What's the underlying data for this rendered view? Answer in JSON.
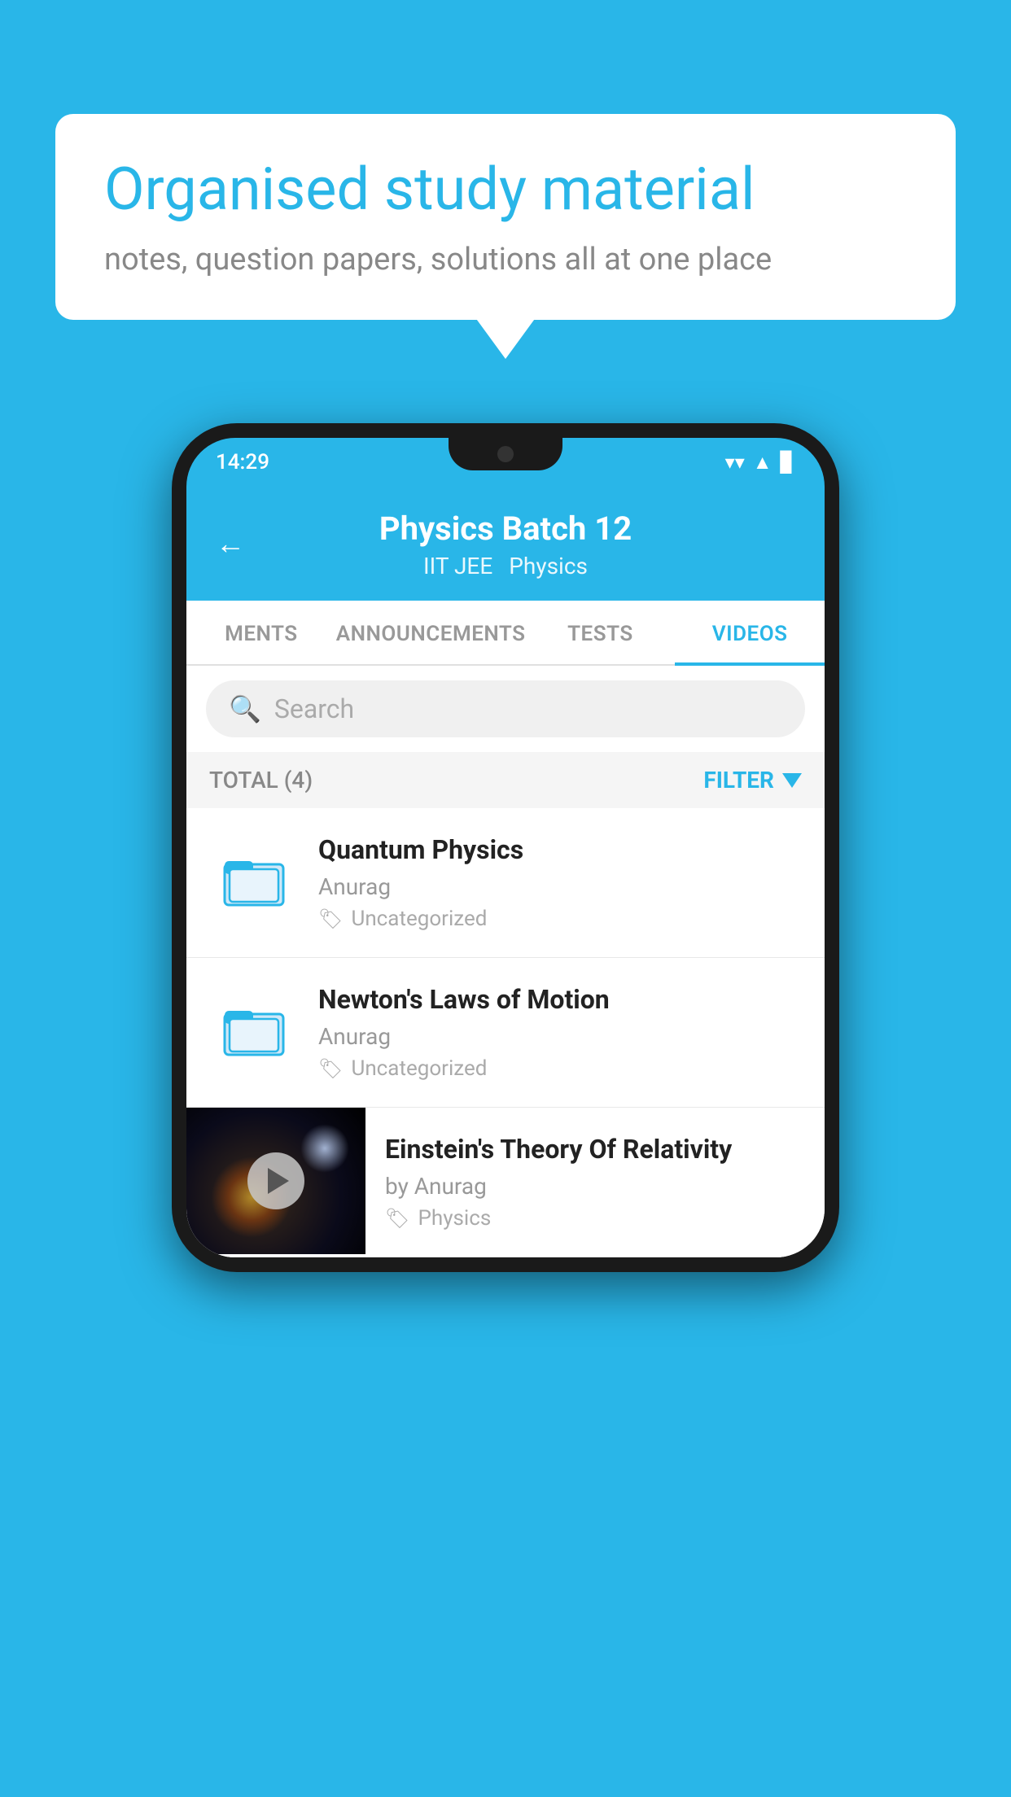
{
  "background_color": "#29b6e8",
  "speech_bubble": {
    "title": "Organised study material",
    "subtitle": "notes, question papers, solutions all at one place"
  },
  "phone": {
    "status_bar": {
      "time": "14:29",
      "wifi": "▼",
      "signal": "▲",
      "battery": "▌"
    },
    "header": {
      "back_label": "←",
      "title": "Physics Batch 12",
      "subtitle_left": "IIT JEE",
      "subtitle_right": "Physics"
    },
    "tabs": [
      {
        "label": "MENTS",
        "active": false
      },
      {
        "label": "ANNOUNCEMENTS",
        "active": false
      },
      {
        "label": "TESTS",
        "active": false
      },
      {
        "label": "VIDEOS",
        "active": true
      }
    ],
    "search": {
      "placeholder": "Search"
    },
    "filter_bar": {
      "total_label": "TOTAL (4)",
      "filter_label": "FILTER"
    },
    "videos": [
      {
        "id": 1,
        "title": "Quantum Physics",
        "author": "Anurag",
        "tag": "Uncategorized",
        "type": "folder"
      },
      {
        "id": 2,
        "title": "Newton's Laws of Motion",
        "author": "Anurag",
        "tag": "Uncategorized",
        "type": "folder"
      },
      {
        "id": 3,
        "title": "Einstein's Theory Of Relativity",
        "author": "by Anurag",
        "tag": "Physics",
        "type": "video"
      }
    ]
  }
}
